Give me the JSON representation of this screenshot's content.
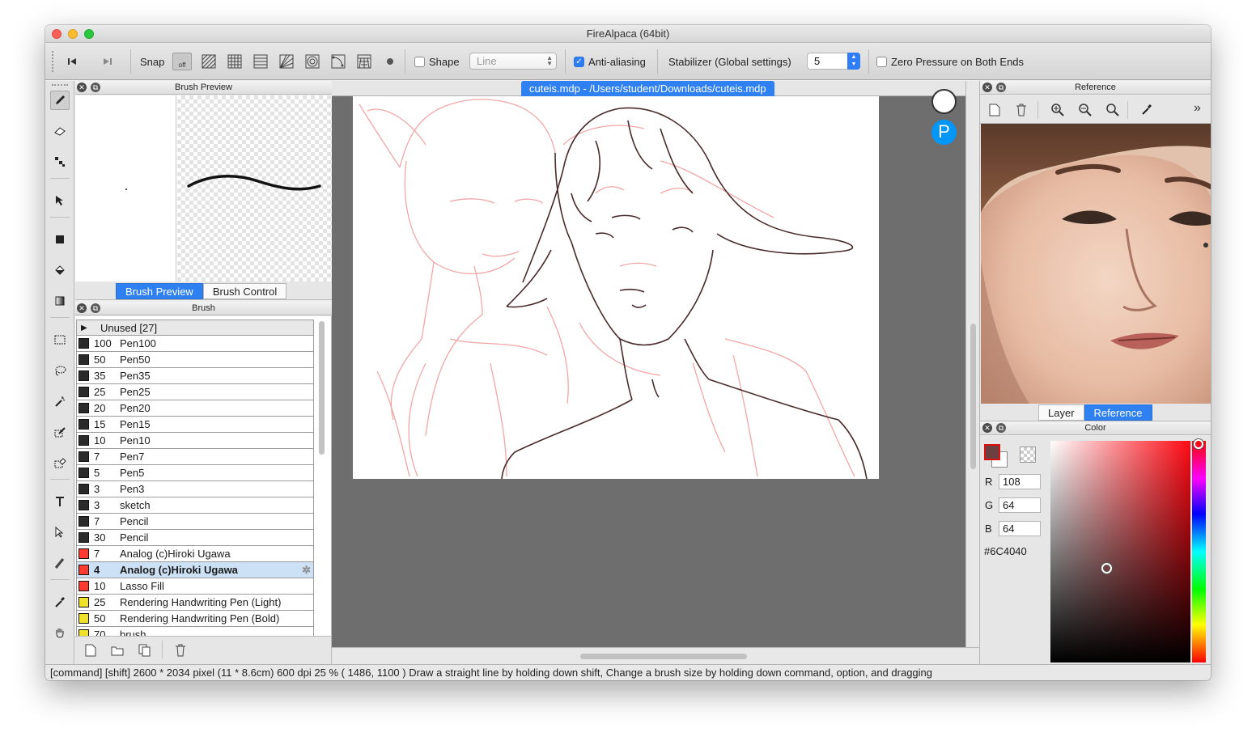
{
  "window": {
    "title": "FireAlpaca (64bit)"
  },
  "toolbar": {
    "snap_label": "Snap",
    "snap_off_label": "off",
    "shape_label": "Shape",
    "shape_value": "Line",
    "antialias_label": "Anti-aliasing",
    "antialias_checked": true,
    "stabilizer_label": "Stabilizer (Global settings)",
    "stabilizer_value": "5",
    "zero_pressure_label": "Zero Pressure on Both Ends"
  },
  "brush_preview_panel": {
    "title": "Brush Preview",
    "tabs": [
      "Brush Preview",
      "Brush Control"
    ]
  },
  "brush_panel": {
    "title": "Brush",
    "group_label": "Unused [27]",
    "items": [
      {
        "size": "100",
        "name": "Pen100",
        "color": "#2a2a2a"
      },
      {
        "size": "50",
        "name": "Pen50",
        "color": "#2a2a2a"
      },
      {
        "size": "35",
        "name": "Pen35",
        "color": "#2a2a2a"
      },
      {
        "size": "25",
        "name": "Pen25",
        "color": "#2a2a2a"
      },
      {
        "size": "20",
        "name": "Pen20",
        "color": "#2a2a2a"
      },
      {
        "size": "15",
        "name": "Pen15",
        "color": "#2a2a2a"
      },
      {
        "size": "10",
        "name": "Pen10",
        "color": "#2a2a2a"
      },
      {
        "size": "7",
        "name": "Pen7",
        "color": "#2a2a2a"
      },
      {
        "size": "5",
        "name": "Pen5",
        "color": "#2a2a2a"
      },
      {
        "size": "3",
        "name": "Pen3",
        "color": "#2a2a2a"
      },
      {
        "size": "3",
        "name": "sketch",
        "color": "#2a2a2a"
      },
      {
        "size": "7",
        "name": "Pencil",
        "color": "#2a2a2a"
      },
      {
        "size": "30",
        "name": "Pencil",
        "color": "#2a2a2a"
      },
      {
        "size": "7",
        "name": "Analog (c)Hiroki Ugawa",
        "color": "#ff3b30"
      },
      {
        "size": "4",
        "name": "Analog (c)Hiroki Ugawa",
        "color": "#ff3b30",
        "selected": true
      },
      {
        "size": "10",
        "name": "Lasso Fill",
        "color": "#ff3b30"
      },
      {
        "size": "25",
        "name": "Rendering Handwriting Pen (Light)",
        "color": "#f0e22a"
      },
      {
        "size": "50",
        "name": "Rendering Handwriting Pen (Bold)",
        "color": "#f0e22a"
      },
      {
        "size": "70",
        "name": "brush",
        "color": "#f0e22a"
      }
    ]
  },
  "document": {
    "tab_title": "cuteis.mdp - /Users/student/Downloads/cuteis.mdp"
  },
  "reference_panel": {
    "title": "Reference",
    "tabs": [
      "Layer",
      "Reference"
    ],
    "more_label": "»"
  },
  "color_panel": {
    "title": "Color",
    "r_label": "R",
    "r_value": "108",
    "g_label": "G",
    "g_value": "64",
    "b_label": "B",
    "b_value": "64",
    "hex": "#6C4040",
    "current_color": "#6c4040",
    "hue_color": "#ff0a14"
  },
  "statusbar": {
    "text": "[command] [shift]    2600 * 2034 pixel    (11 * 8.6cm)    600 dpi    25 %    ( 1486, 1100 )    Draw a straight line by holding down shift, Change a brush size by holding down command, option, and dragging"
  }
}
